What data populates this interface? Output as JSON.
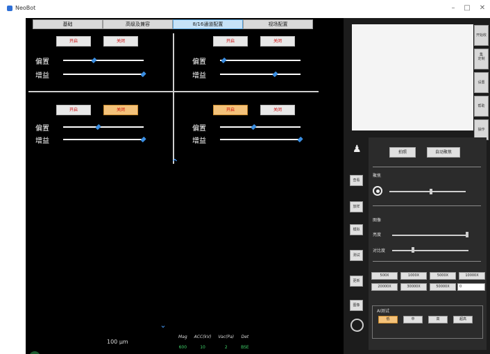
{
  "window": {
    "title": "NeoBot",
    "min": "–",
    "max": "□",
    "close": "✕"
  },
  "tabs": [
    {
      "label": "基础"
    },
    {
      "label": "高级及兼容"
    },
    {
      "label": "8/16通道配置"
    },
    {
      "label": "视场配置"
    }
  ],
  "quadrants": [
    {
      "open_label": "开启",
      "close_label": "关闭",
      "open_active": false,
      "close_active": false,
      "slider1_label": "偏置",
      "slider1_value": 0.37,
      "slider2_label": "增益",
      "slider2_value": 1.0
    },
    {
      "open_label": "开启",
      "close_label": "关闭",
      "open_active": false,
      "close_active": false,
      "slider1_label": "偏置",
      "slider1_value": 0.02,
      "slider2_label": "增益",
      "slider2_value": 0.68
    },
    {
      "open_label": "开启",
      "close_label": "关闭",
      "open_active": false,
      "close_active": true,
      "slider1_label": "偏置",
      "slider1_value": 0.42,
      "slider2_label": "增益",
      "slider2_value": 1.0
    },
    {
      "open_label": "开启",
      "close_label": "关闭",
      "open_active": true,
      "close_active": false,
      "slider1_label": "偏置",
      "slider1_value": 0.4,
      "slider2_label": "增益",
      "slider2_value": 1.0
    }
  ],
  "bottom": {
    "distance": "100 μm",
    "stats": [
      {
        "label": "Mag",
        "value": "600"
      },
      {
        "label": "ACC(kV)",
        "value": "10"
      },
      {
        "label": "Vac(Pa)",
        "value": "2"
      },
      {
        "label": "Det",
        "value": "BSE"
      }
    ]
  },
  "right_panel": {
    "side_tabs": [
      "开始收集",
      "定制",
      "设置",
      "帮助",
      "操作"
    ],
    "top_buttons": {
      "capture": "拍照",
      "auto_focus": "自动聚焦"
    },
    "focus_label": "聚焦",
    "image_label": "图像",
    "brightness_label": "亮度",
    "contrast_label": "对比度",
    "resolutions": [
      "500X",
      "1000X",
      "5000X",
      "10000X",
      "20000X",
      "30000X",
      "50000X"
    ],
    "custom_res_value": "0",
    "ai_label": "AI测试",
    "ai_buttons": [
      "低",
      "中",
      "高",
      "超高"
    ],
    "ai_active_index": 0,
    "left_icons": [
      "查看",
      "放样",
      "模拟",
      "测试",
      "更新",
      "图像"
    ]
  }
}
